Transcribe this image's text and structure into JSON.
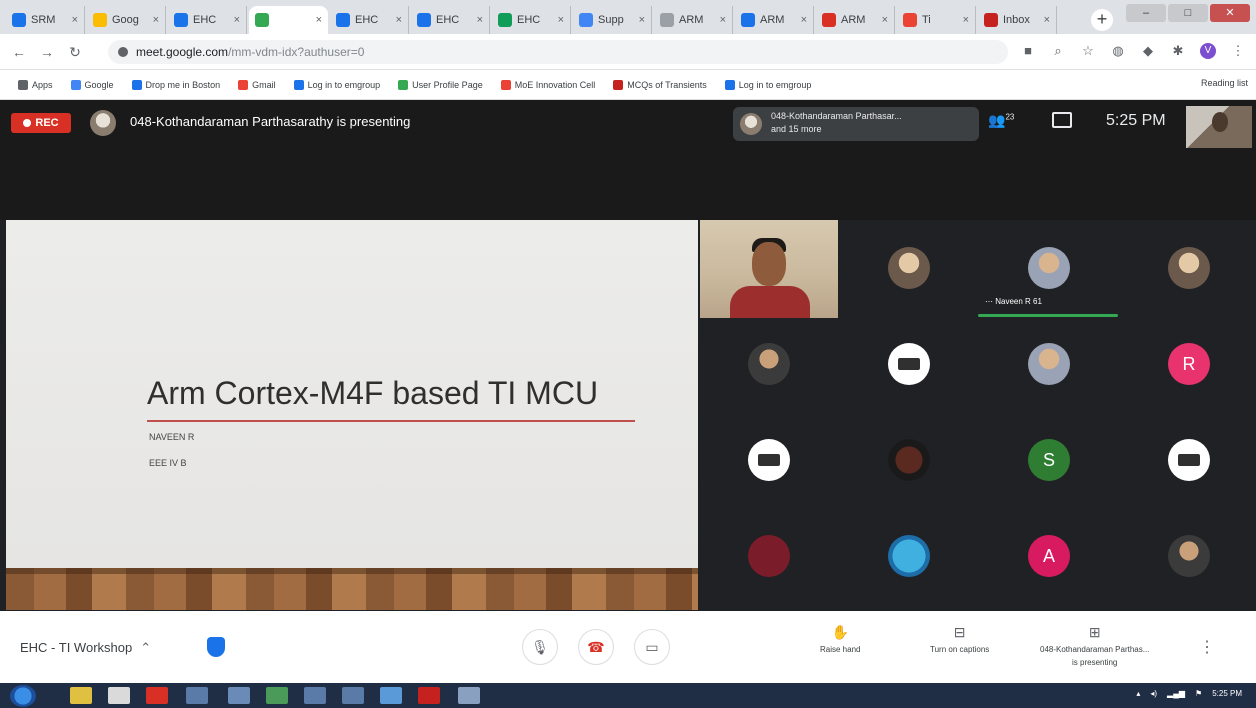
{
  "browser": {
    "tabs": [
      {
        "label": "SRM",
        "color": "#1a73e8"
      },
      {
        "label": "Goog",
        "color": "#fbbc04"
      },
      {
        "label": "EHC",
        "color": "#1a73e8"
      },
      {
        "label": "",
        "color": "#34a853",
        "active": true
      },
      {
        "label": "EHC",
        "color": "#1a73e8"
      },
      {
        "label": "EHC",
        "color": "#1a73e8"
      },
      {
        "label": "EHC",
        "color": "#0f9d58"
      },
      {
        "label": "Supp",
        "color": "#4285f4"
      },
      {
        "label": "ARM",
        "color": "#9aa0a6"
      },
      {
        "label": "ARM",
        "color": "#1a73e8"
      },
      {
        "label": "ARM",
        "color": "#d93025"
      },
      {
        "label": "Ti",
        "color": "#ea4335"
      },
      {
        "label": "Inbox",
        "color": "#c5221f"
      }
    ],
    "new_tab": "+",
    "window_controls": [
      "–",
      "□",
      "✕"
    ],
    "url_host": "meet.google.com",
    "url_path": "/mm-vdm-idx?authuser=0",
    "bookmarks": [
      {
        "label": "Apps",
        "color": "#5f6368"
      },
      {
        "label": "Google",
        "color": "#4285f4"
      },
      {
        "label": "Drop me in Boston",
        "color": "#1a73e8"
      },
      {
        "label": "Gmail",
        "color": "#ea4335"
      },
      {
        "label": "Log in to emgroup",
        "color": "#1a73e8"
      },
      {
        "label": "User Profile Page",
        "color": "#34a853"
      },
      {
        "label": "MoE Innovation Cell",
        "color": "#ea4335"
      },
      {
        "label": "MCQs of Transients",
        "color": "#c5221f"
      },
      {
        "label": "Log in to emgroup",
        "color": "#1a73e8"
      }
    ],
    "reading_list": "Reading list"
  },
  "meet": {
    "rec_label": "REC",
    "presenting_text": "048-Kothandaraman Parthasarathy is presenting",
    "pill_line1": "048-Kothandaraman Parthasar...",
    "pill_line2": "and 15 more",
    "people_count": "23",
    "time": "5:25 PM",
    "speaking_name": "Naveen R 61",
    "meeting_name": "EHC - TI Workshop",
    "raise_hand": "Raise hand",
    "captions": "Turn on captions",
    "presenting_line1": "048-Kothandaraman Parthas...",
    "presenting_line2": "is presenting",
    "tiles": [
      {
        "kind": "video"
      },
      {
        "kind": "photo"
      },
      {
        "kind": "photo2"
      },
      {
        "kind": "photo"
      },
      {
        "kind": "photo3"
      },
      {
        "kind": "cam"
      },
      {
        "kind": "photo2"
      },
      {
        "kind": "letter",
        "letter": "R",
        "cls": "letter-r"
      },
      {
        "kind": "cam"
      },
      {
        "kind": "dark"
      },
      {
        "kind": "letter",
        "letter": "S",
        "cls": "letter-s"
      },
      {
        "kind": "cam"
      },
      {
        "kind": "maroon"
      },
      {
        "kind": "blue"
      },
      {
        "kind": "letter",
        "letter": "A",
        "cls": "letter-a"
      },
      {
        "kind": "photo3"
      }
    ]
  },
  "slide": {
    "title": "Arm Cortex-M4F based TI MCU",
    "author": "NAVEEN R",
    "class_name": "EEE IV B"
  },
  "taskbar": {
    "time": "5:25 PM"
  },
  "colors": {
    "rec": "#d93025",
    "speak_bar": "#34a853",
    "hangup": "#d93025"
  }
}
